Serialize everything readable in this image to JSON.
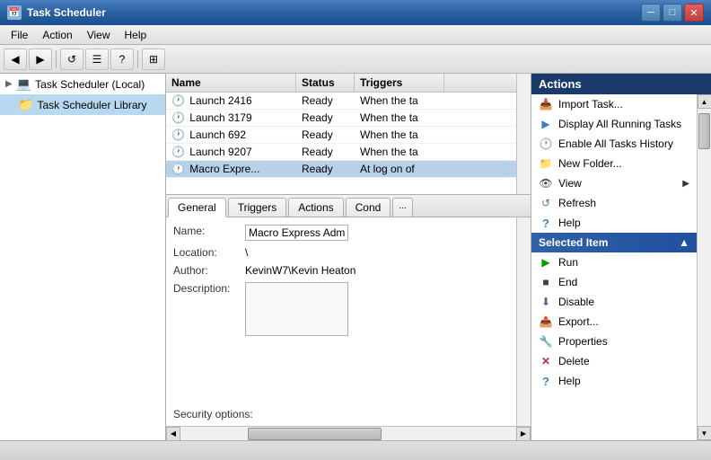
{
  "window": {
    "title": "Task Scheduler",
    "icon": "📅"
  },
  "titlebar": {
    "minimize": "─",
    "maximize": "□",
    "close": "✕"
  },
  "menubar": {
    "items": [
      "File",
      "Action",
      "View",
      "Help"
    ]
  },
  "toolbar": {
    "buttons": [
      "◀",
      "▶",
      "↺",
      "☰",
      "?",
      "⊞"
    ]
  },
  "tree": {
    "items": [
      {
        "label": "Task Scheduler (Local)",
        "icon": "💻",
        "indent": 0
      },
      {
        "label": "Task Scheduler Library",
        "icon": "📁",
        "indent": 1
      }
    ]
  },
  "tasklist": {
    "columns": [
      "Name",
      "Status",
      "Triggers"
    ],
    "rows": [
      {
        "name": "Launch 2416",
        "status": "Ready",
        "triggers": "When the ta"
      },
      {
        "name": "Launch 3179",
        "status": "Ready",
        "triggers": "When the ta"
      },
      {
        "name": "Launch 692",
        "status": "Ready",
        "triggers": "When the ta"
      },
      {
        "name": "Launch 9207",
        "status": "Ready",
        "triggers": "When the ta"
      },
      {
        "name": "Macro Expre...",
        "status": "Ready",
        "triggers": "At log on of"
      }
    ]
  },
  "tabs": {
    "items": [
      "General",
      "Triggers",
      "Actions",
      "Cond",
      "..."
    ]
  },
  "detail": {
    "name_label": "Name:",
    "name_value": "Macro Express Admin",
    "location_label": "Location:",
    "location_value": "\\",
    "author_label": "Author:",
    "author_value": "KevinW7\\Kevin Heaton",
    "description_label": "Description:",
    "description_value": "",
    "security_label": "Security options:"
  },
  "actions_panel": {
    "header": "Actions",
    "general_items": [
      {
        "icon": "📥",
        "label": "Import Task..."
      },
      {
        "icon": "▶",
        "label": "Display All Running Tasks"
      },
      {
        "icon": "🕐",
        "label": "Enable All Tasks History"
      },
      {
        "icon": "📁",
        "label": "New Folder..."
      },
      {
        "icon": "👁",
        "label": "View",
        "has_arrow": true
      },
      {
        "icon": "↺",
        "label": "Refresh"
      },
      {
        "icon": "?",
        "label": "Help"
      }
    ],
    "selected_header": "Selected Item",
    "selected_items": [
      {
        "icon": "▶",
        "label": "Run",
        "color": "green"
      },
      {
        "icon": "■",
        "label": "End",
        "color": "black"
      },
      {
        "icon": "⬇",
        "label": "Disable",
        "color": "blue"
      },
      {
        "icon": "📤",
        "label": "Export..."
      },
      {
        "icon": "🔧",
        "label": "Properties"
      },
      {
        "icon": "✕",
        "label": "Delete",
        "color": "red"
      },
      {
        "icon": "?",
        "label": "Help"
      }
    ]
  },
  "statusbar": {
    "text": ""
  }
}
